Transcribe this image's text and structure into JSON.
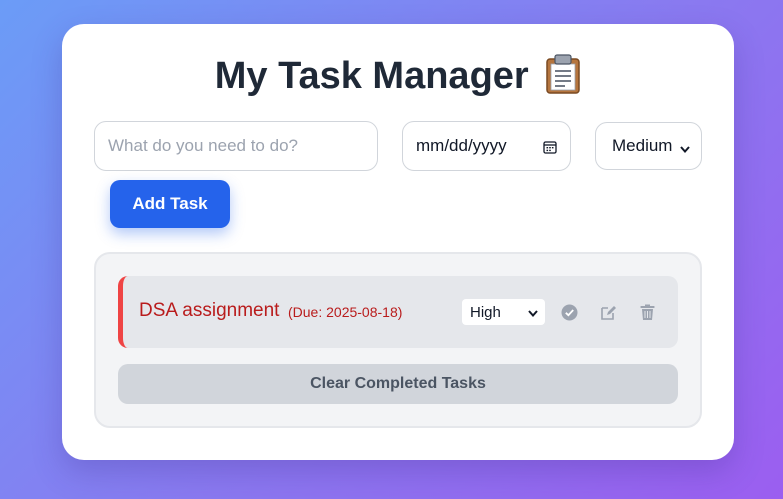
{
  "app": {
    "title": "My Task Manager",
    "title_emoji": "📋"
  },
  "form": {
    "task_placeholder": "What do you need to do?",
    "task_value": "",
    "date_placeholder": "mm/dd/yyyy",
    "priority_selected": "Medium",
    "add_button_label": "Add Task"
  },
  "tasks": [
    {
      "name": "DSA assignment",
      "due_text": "(Due: 2025-08-18)",
      "priority": "High",
      "priority_color": "#ef4444",
      "actions": [
        "check-circle-icon",
        "edit-icon",
        "trash-icon"
      ]
    }
  ],
  "list": {
    "clear_completed_label": "Clear Completed Tasks"
  },
  "colors": {
    "accent": "#2563eb",
    "high_priority": "#ef4444",
    "task_text": "#b91c1c"
  }
}
